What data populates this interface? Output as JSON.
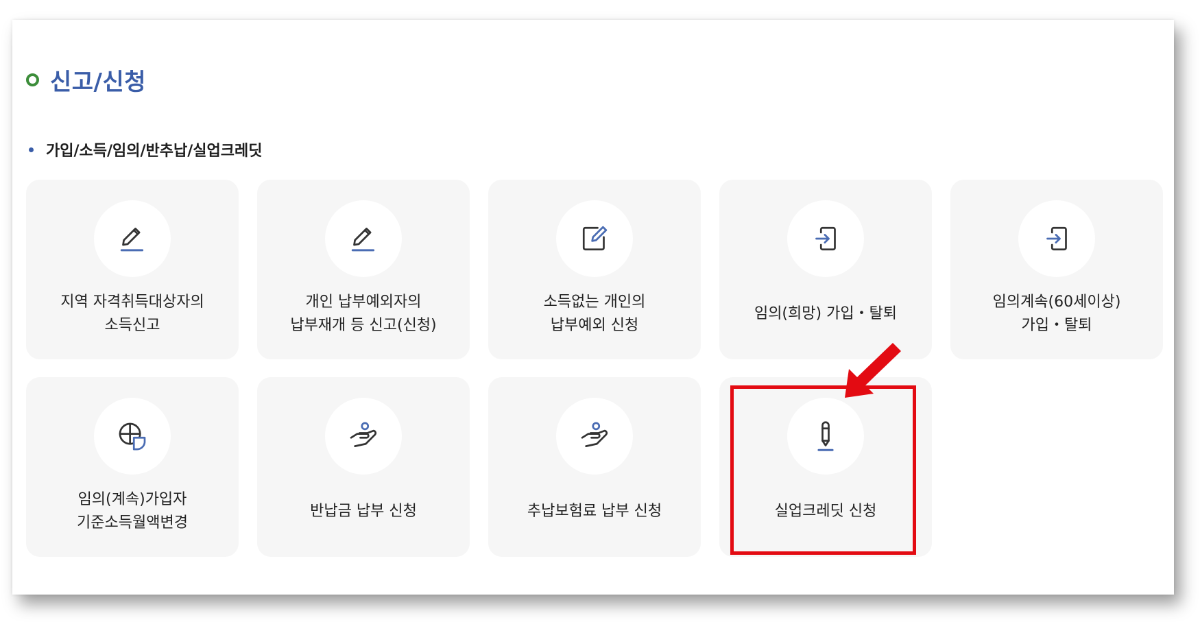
{
  "section": {
    "title": "신고/신청"
  },
  "group": {
    "title": "가입/소득/임의/반추납/실업크레딧"
  },
  "cards": [
    {
      "icon": "pencil-underline-icon",
      "line1": "지역 자격취득대상자의",
      "line2": "소득신고"
    },
    {
      "icon": "pencil-underline-icon",
      "line1": "개인 납부예외자의",
      "line2": "납부재개 등 신고(신청)"
    },
    {
      "icon": "edit-box-icon",
      "line1": "소득없는 개인의",
      "line2": "납부예외 신청"
    },
    {
      "icon": "sign-in-icon",
      "line1": "임의(희망) 가입・탈퇴",
      "line2": ""
    },
    {
      "icon": "sign-in-icon",
      "line1": "임의계속(60세이상)",
      "line2": "가입・탈퇴"
    },
    {
      "icon": "pie-chart-icon",
      "line1": "임의(계속)가입자",
      "line2": "기준소득월액변경"
    },
    {
      "icon": "hand-person-icon",
      "line1": "반납금 납부 신청",
      "line2": ""
    },
    {
      "icon": "hand-person-icon",
      "line1": "추납보험료 납부 신청",
      "line2": ""
    },
    {
      "icon": "pencil-vertical-icon",
      "line1": "실업크레딧 신청",
      "line2": ""
    }
  ],
  "colors": {
    "heading": "#3a5da8",
    "heading_dot": "#3c8d3a",
    "accent": "#4a6cb3",
    "highlight": "#e30b12",
    "card_bg": "#f6f6f6"
  }
}
